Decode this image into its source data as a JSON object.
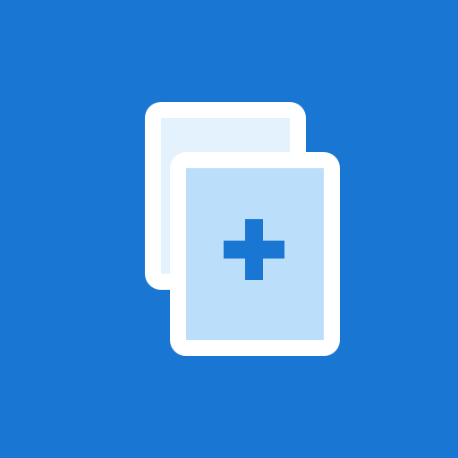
{
  "app": {
    "icon_name": "copy-add-icon",
    "background_color": "#1976D2",
    "back_card_color": "#E3F2FD",
    "front_card_color": "#BBDEFB",
    "border_color": "#FFFFFF",
    "plus_color": "#1976D2"
  }
}
